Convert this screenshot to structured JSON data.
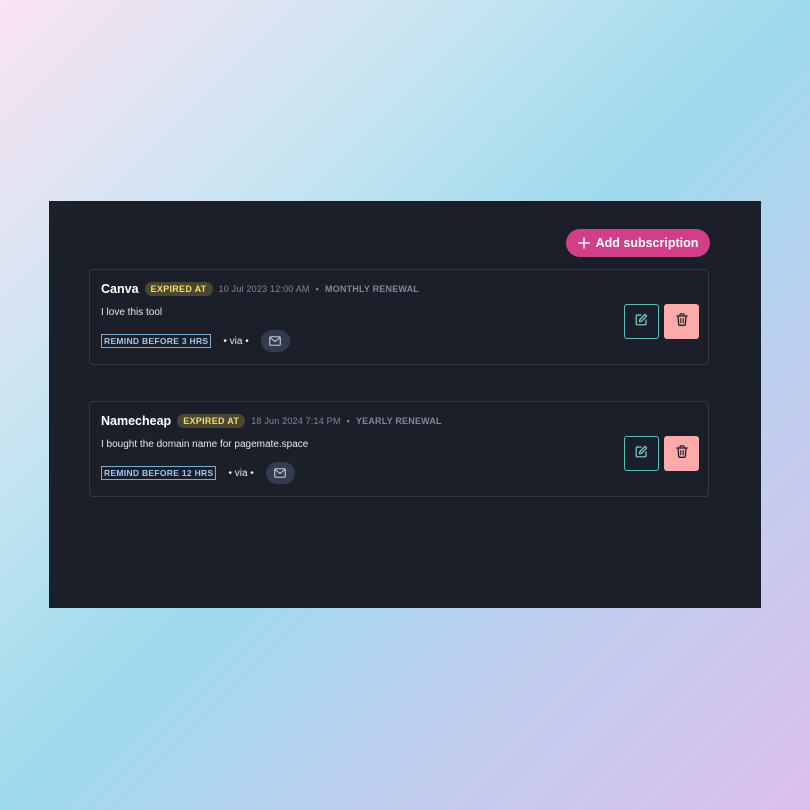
{
  "toolbar": {
    "add_label": "Add subscription",
    "add_icon": "plus-icon"
  },
  "colors": {
    "accent": "#d23f87",
    "panel_bg": "#1b1f29",
    "badge_text": "#f1dd6e",
    "edit_border": "#58c0ba",
    "delete_bg": "#fca9aa"
  },
  "subscriptions": [
    {
      "name": "Canva",
      "status_badge": "EXPIRED AT",
      "expiry": "10 Jul 2023 12:00 AM",
      "separator": "•",
      "renewal": "MONTHLY RENEWAL",
      "description": "I love this tool",
      "remind": "REMIND BEFORE 3 HRS",
      "via": "• via •",
      "channel_icon": "mail-icon",
      "edit_icon": "edit-icon",
      "delete_icon": "trash-icon"
    },
    {
      "name": "Namecheap",
      "status_badge": "EXPIRED AT",
      "expiry": "18 Jun 2024 7:14 PM",
      "separator": "•",
      "renewal": "YEARLY RENEWAL",
      "description": "I bought the domain name for pagemate.space",
      "remind": "REMIND BEFORE 12 HRS",
      "via": "• via •",
      "channel_icon": "mail-icon",
      "edit_icon": "edit-icon",
      "delete_icon": "trash-icon"
    }
  ]
}
